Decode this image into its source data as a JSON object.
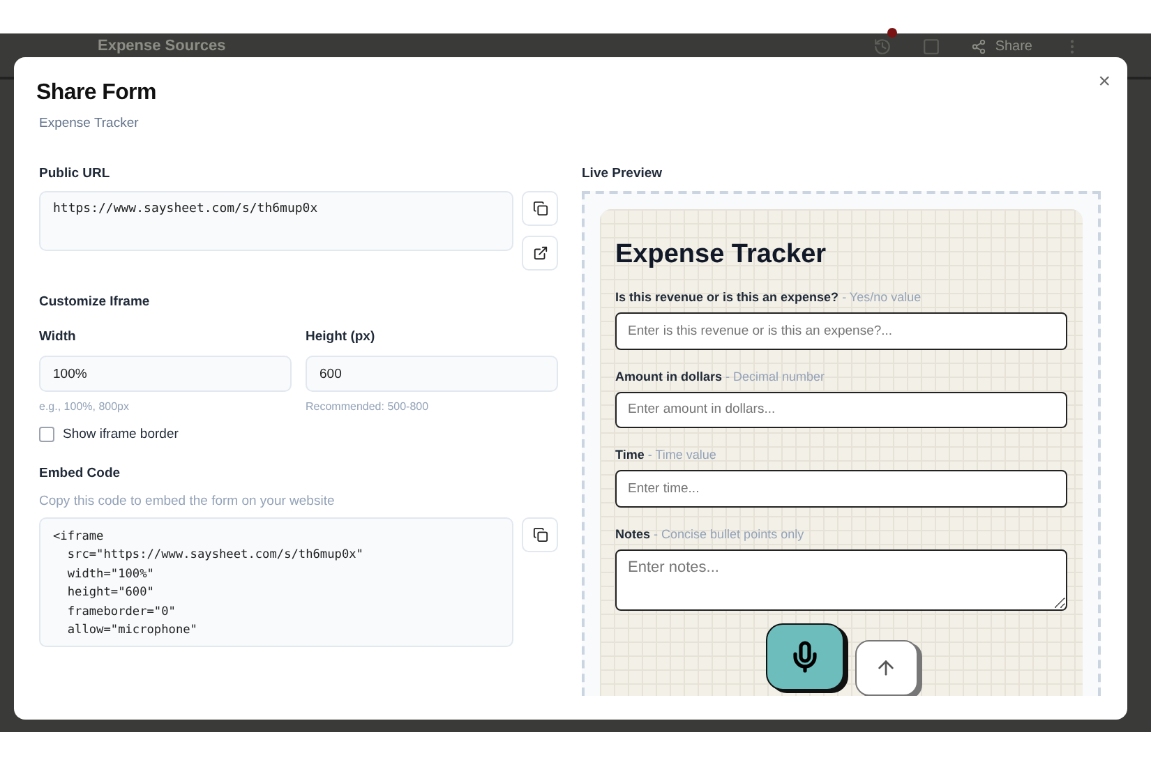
{
  "background_header": {
    "title": "Expense Sources",
    "share_label": "Share",
    "history_badge": true
  },
  "dialog": {
    "title": "Share Form",
    "subtitle": "Expense Tracker",
    "close": "×"
  },
  "public_url": {
    "label": "Public URL",
    "value": "https://www.saysheet.com/s/th6mup0x"
  },
  "customize": {
    "heading": "Customize Iframe",
    "width": {
      "label": "Width",
      "value": "100%",
      "hint": "e.g., 100%, 800px"
    },
    "height": {
      "label": "Height (px)",
      "value": "600",
      "hint": "Recommended: 500-800"
    },
    "show_border": {
      "label": "Show iframe border",
      "checked": false
    }
  },
  "embed": {
    "heading": "Embed Code",
    "description": "Copy this code to embed the form on your website",
    "code_lines": [
      "<iframe",
      "  src=\"https://www.saysheet.com/s/th6mup0x\"",
      "  width=\"100%\"",
      "  height=\"600\"",
      "  frameborder=\"0\"",
      "  allow=\"microphone\""
    ]
  },
  "preview": {
    "label": "Live Preview",
    "title": "Expense Tracker",
    "fields": [
      {
        "label": "Is this revenue or is this an expense?",
        "hint": "- Yes/no value",
        "placeholder": "Enter is this revenue or is this an expense?...",
        "kind": "input"
      },
      {
        "label": "Amount in dollars",
        "hint": "- Decimal number",
        "placeholder": "Enter amount in dollars...",
        "kind": "input"
      },
      {
        "label": "Time",
        "hint": "- Time value",
        "placeholder": "Enter time...",
        "kind": "input"
      },
      {
        "label": "Notes",
        "hint": "- Concise bullet points only",
        "placeholder": "Enter notes...",
        "kind": "textarea"
      }
    ]
  }
}
